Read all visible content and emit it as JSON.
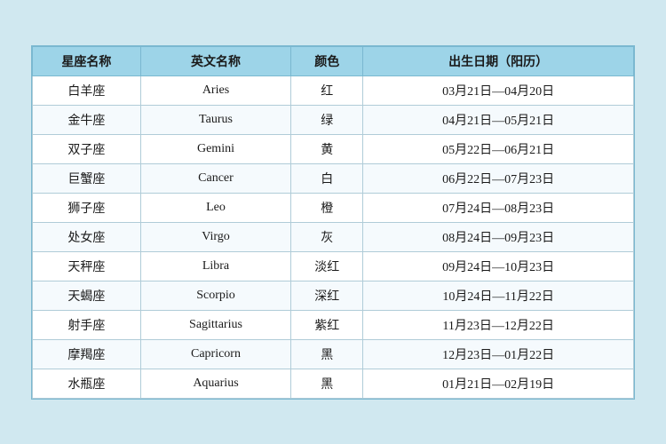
{
  "table": {
    "headers": {
      "zh_name": "星座名称",
      "en_name": "英文名称",
      "color": "颜色",
      "date": "出生日期（阳历）"
    },
    "rows": [
      {
        "zh": "白羊座",
        "en": "Aries",
        "color": "红",
        "date": "03月21日—04月20日"
      },
      {
        "zh": "金牛座",
        "en": "Taurus",
        "color": "绿",
        "date": "04月21日—05月21日"
      },
      {
        "zh": "双子座",
        "en": "Gemini",
        "color": "黄",
        "date": "05月22日—06月21日"
      },
      {
        "zh": "巨蟹座",
        "en": "Cancer",
        "color": "白",
        "date": "06月22日—07月23日"
      },
      {
        "zh": "狮子座",
        "en": "Leo",
        "color": "橙",
        "date": "07月24日—08月23日"
      },
      {
        "zh": "处女座",
        "en": "Virgo",
        "color": "灰",
        "date": "08月24日—09月23日"
      },
      {
        "zh": "天秤座",
        "en": "Libra",
        "color": "淡红",
        "date": "09月24日—10月23日"
      },
      {
        "zh": "天蝎座",
        "en": "Scorpio",
        "color": "深红",
        "date": "10月24日—11月22日"
      },
      {
        "zh": "射手座",
        "en": "Sagittarius",
        "color": "紫红",
        "date": "11月23日—12月22日"
      },
      {
        "zh": "摩羯座",
        "en": "Capricorn",
        "color": "黑",
        "date": "12月23日—01月22日"
      },
      {
        "zh": "水瓶座",
        "en": "Aquarius",
        "color": "黑",
        "date": "01月21日—02月19日"
      }
    ]
  }
}
